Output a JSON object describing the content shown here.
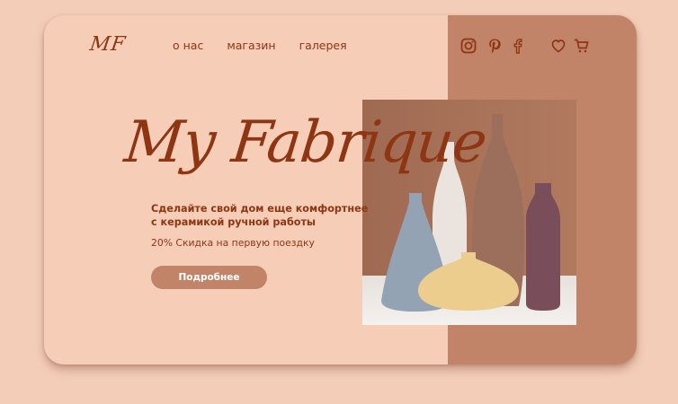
{
  "logo": {
    "text": "MF"
  },
  "nav": {
    "items": [
      "о нас",
      "магазин",
      "галерея"
    ]
  },
  "icons": {
    "instagram": "instagram-icon",
    "pinterest": "pinterest-icon",
    "facebook": "facebook-icon",
    "heart": "heart-icon",
    "cart": "cart-icon"
  },
  "hero": {
    "title": "My Fabrique",
    "subtitle_line1": "Сделайте свой дом еще комфортнее",
    "subtitle_line2": "с керамикой ручной работы",
    "discount": "20% Скидка на первую поездку",
    "button": "Подробнее"
  },
  "colors": {
    "background": "#f4cdb8",
    "accent": "#8e3613",
    "panel": "#c18468",
    "button": "#c18468"
  }
}
